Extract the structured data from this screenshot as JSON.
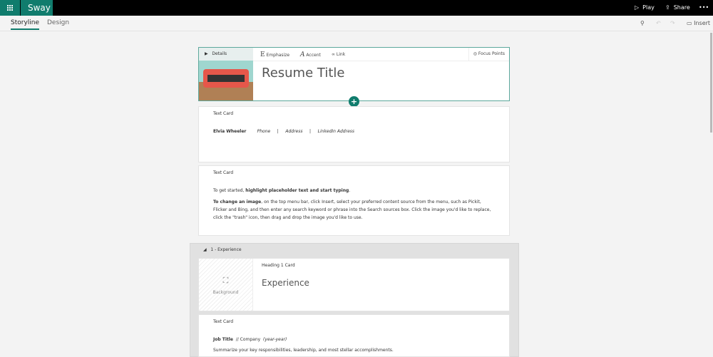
{
  "app": {
    "name": "Sway"
  },
  "topbar": {
    "play": "Play",
    "share": "Share",
    "more": "•••"
  },
  "tabs": [
    {
      "label": "Storyline",
      "active": true
    },
    {
      "label": "Design",
      "active": false
    }
  ],
  "toolbar": {
    "insert": "Insert"
  },
  "title_card": {
    "details": "Details",
    "emphasize": "Emphasize",
    "accent": "Accent",
    "link": "Link",
    "focus_points": "Focus Points",
    "title": "Resume Title"
  },
  "cards": [
    {
      "type": "Text Card",
      "name": "Elvia Wheeler",
      "phone": "Phone",
      "sep": "|",
      "address": "Address",
      "linkedin": "LinkedIn Address"
    },
    {
      "type": "Text Card",
      "line1_pre": "To get started, ",
      "line1_bold": "highlight placeholder text and start typing",
      "line1_post": ".",
      "para_bold": "To change an image",
      "para": ", on the top menu bar, click Insert, select your preferred content source from the menu, such as Pickit, Flicker and Bing, and then enter any search keyword or phrase into the Search sources box. Click the image you'd like to replace, click the \"trash\" icon, then drag and drop the image you'd like to use."
    }
  ],
  "section": {
    "title": "1 - Experience",
    "heading_card": {
      "type": "Heading 1 Card",
      "background": "Background",
      "heading": "Experience"
    },
    "text_card": {
      "type": "Text Card",
      "job_title": "Job Title",
      "company": "// Company",
      "years": "(year-year)",
      "summary": "Summarize your key responsibilities, leadership, and most stellar accomplishments."
    }
  },
  "colors": {
    "accent": "#107c6d",
    "topbar": "#000000"
  }
}
